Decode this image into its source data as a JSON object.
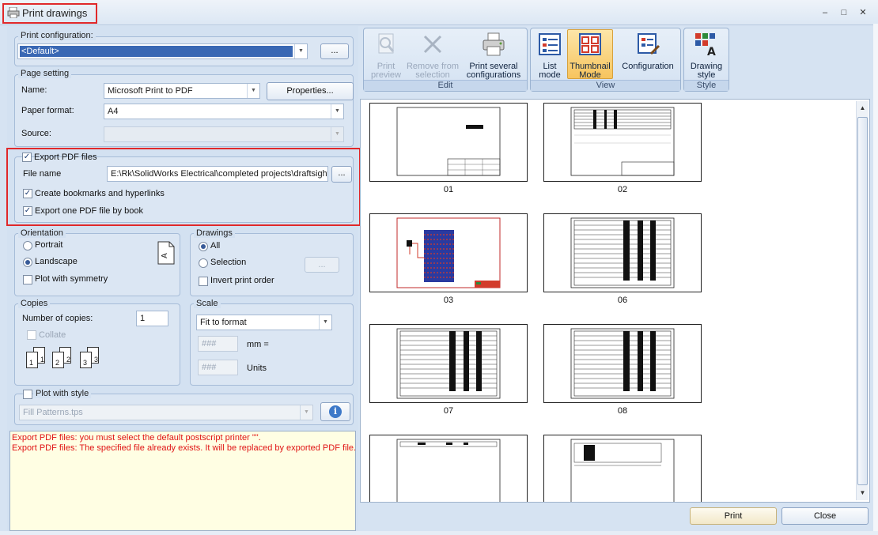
{
  "window": {
    "title": "Print drawings",
    "minimize": "–",
    "maximize": "□",
    "close": "✕"
  },
  "print_configuration": {
    "label": "Print configuration:",
    "value": "<Default>",
    "browse_label": "..."
  },
  "page_setting": {
    "label": "Page setting",
    "name_label": "Name:",
    "name_value": "Microsoft Print to PDF",
    "properties_label": "Properties...",
    "paper_label": "Paper format:",
    "paper_value": "A4",
    "source_label": "Source:",
    "source_value": ""
  },
  "export_pdf": {
    "checkbox_label": "Export PDF files",
    "checked": true,
    "file_name_label": "File name",
    "file_name_value": "E:\\Rk\\SolidWorks Electrical\\completed projects\\draftsight",
    "browse_label": "...",
    "bookmarks_label": "Create bookmarks and hyperlinks",
    "bookmarks_checked": true,
    "one_per_book_label": "Export one PDF file by book",
    "one_per_book_checked": true
  },
  "orientation": {
    "label": "Orientation",
    "portrait": "Portrait",
    "landscape": "Landscape",
    "selected": "landscape",
    "symmetry_label": "Plot with symmetry",
    "symmetry_checked": false
  },
  "drawings": {
    "label": "Drawings",
    "all": "All",
    "selection": "Selection",
    "selected": "all",
    "selection_button": "...",
    "invert_label": "Invert print order",
    "invert_checked": false
  },
  "copies": {
    "label": "Copies",
    "number_label": "Number of copies:",
    "number_value": "1",
    "collate_label": "Collate",
    "collate_checked": false,
    "icon_digits": [
      "1",
      "1",
      "2",
      "2",
      "3",
      "3"
    ]
  },
  "scale": {
    "label": "Scale",
    "value": "Fit to format",
    "field1": "###",
    "unit1": "mm =",
    "field2": "###",
    "unit2": "Units"
  },
  "plot_style": {
    "checkbox_label": "Plot with style",
    "checked": false,
    "value": "Fill Patterns.tps"
  },
  "messages": [
    "Export PDF files: you must select the default postscript printer \"\".",
    "Export PDF files: The specified file already exists. It will be replaced by exported PDF file."
  ],
  "ribbon": {
    "edit": {
      "caption": "Edit",
      "print_preview": [
        "Print",
        "preview"
      ],
      "remove_from_selection": [
        "Remove from",
        "selection"
      ],
      "print_several": [
        "Print several",
        "configurations"
      ]
    },
    "view": {
      "caption": "View",
      "list_mode": [
        "List",
        "mode"
      ],
      "thumbnail_mode": [
        "Thumbnail",
        "Mode"
      ],
      "configuration": "Configuration"
    },
    "style": {
      "caption": "Style",
      "drawing_style": [
        "Drawing",
        "style"
      ]
    }
  },
  "thumbnails": [
    {
      "label": "01",
      "kind": "title"
    },
    {
      "label": "02",
      "kind": "table-top"
    },
    {
      "label": "03",
      "kind": "colored"
    },
    {
      "label": "06",
      "kind": "table-full"
    },
    {
      "label": "07",
      "kind": "table-full"
    },
    {
      "label": "08",
      "kind": "table-full"
    },
    {
      "label": "",
      "kind": "list"
    },
    {
      "label": "",
      "kind": "small-table"
    }
  ],
  "footer": {
    "print_label": "Print",
    "close_label": "Close"
  },
  "colors": {
    "highlight": "#e0282a",
    "message_text": "#e01414",
    "message_bg": "#fffee3",
    "selected_tab": "#f7c45e"
  }
}
